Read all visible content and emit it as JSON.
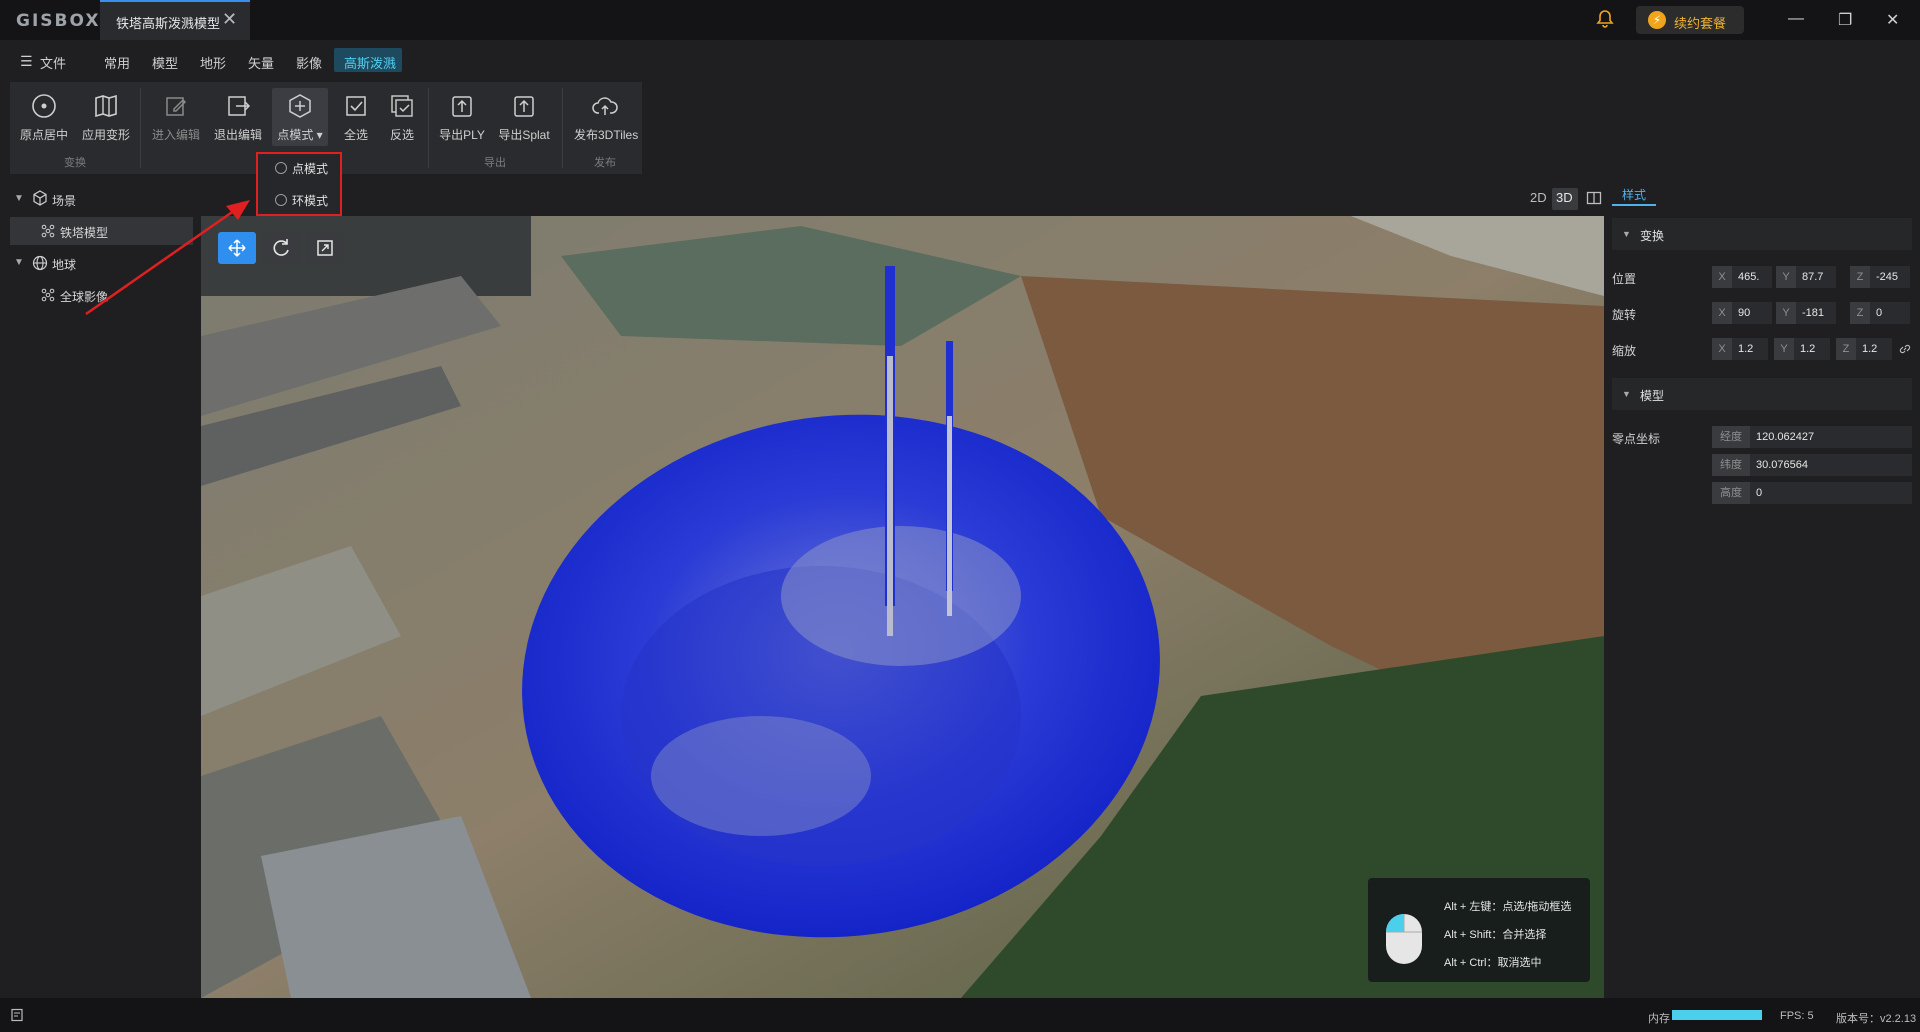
{
  "app": {
    "logo": "GISBOX",
    "tab_title": "铁塔高斯泼溅模型",
    "upgrade_label": "续约套餐"
  },
  "menu": {
    "file": "文件",
    "items": [
      "常用",
      "模型",
      "地形",
      "矢量",
      "影像",
      "高斯泼溅"
    ],
    "active": "高斯泼溅"
  },
  "toolbar": {
    "tools": [
      {
        "label": "原点居中",
        "icon": "target-icon"
      },
      {
        "label": "应用变形",
        "icon": "map-transform-icon"
      },
      {
        "label": "进入编辑",
        "icon": "edit-icon"
      },
      {
        "label": "退出编辑",
        "icon": "exit-edit-icon"
      },
      {
        "label": "点模式",
        "icon": "hexagon-plus-icon"
      },
      {
        "label": "全选",
        "icon": "check-square-icon"
      },
      {
        "label": "反选",
        "icon": "invert-select-icon"
      },
      {
        "label": "导出PLY",
        "icon": "export-icon"
      },
      {
        "label": "导出Splat",
        "icon": "export-icon"
      },
      {
        "label": "发布3DTiles",
        "icon": "cloud-upload-icon"
      }
    ],
    "groups": [
      "变换",
      "导出",
      "发布"
    ],
    "dropdown": [
      "点模式",
      "环模式"
    ]
  },
  "tree": {
    "scene": "场景",
    "scene_child": "铁塔模型",
    "globe": "地球",
    "globe_child": "全球影像"
  },
  "view": {
    "modes": [
      "2D",
      "3D"
    ],
    "hints": [
      "Alt + 左键：点选/拖动框选",
      "Alt + Shift：合并选择",
      "Alt + Ctrl：取消选中"
    ]
  },
  "panel": {
    "tab": "样式",
    "transform_title": "变换",
    "position_label": "位置",
    "rotation_label": "旋转",
    "scale_label": "缩放",
    "axes": [
      "X",
      "Y",
      "Z"
    ],
    "position": [
      "465.",
      "87.7",
      "-245"
    ],
    "rotation": [
      "90",
      "-181",
      "0"
    ],
    "scale": [
      "1.2",
      "1.2",
      "1.2"
    ],
    "model_title": "模型",
    "origin_label": "零点坐标",
    "lon_label": "经度",
    "lon": "120.062427",
    "lat_label": "纬度",
    "lat": "30.076564",
    "height_label": "高度",
    "height": "0"
  },
  "status": {
    "memory_label": "内存",
    "fps": "FPS: 5",
    "version": "版本号：v2.2.13"
  }
}
